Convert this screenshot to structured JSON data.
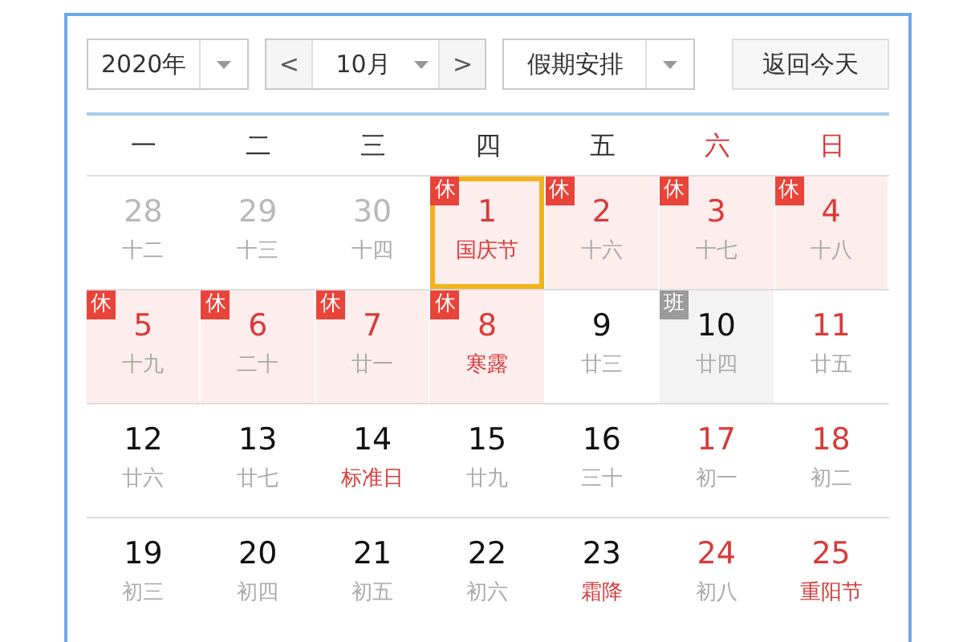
{
  "toolbar": {
    "year": "2020年",
    "prev": "<",
    "month": "10月",
    "next": ">",
    "holiday": "假期安排",
    "today_button": "返回今天"
  },
  "weekdays": [
    {
      "label": "一",
      "weekend": false
    },
    {
      "label": "二",
      "weekend": false
    },
    {
      "label": "三",
      "weekend": false
    },
    {
      "label": "四",
      "weekend": false
    },
    {
      "label": "五",
      "weekend": false
    },
    {
      "label": "六",
      "weekend": true
    },
    {
      "label": "日",
      "weekend": true
    }
  ],
  "weeks": [
    [
      {
        "day": "28",
        "lunar": "十二",
        "other_month": true,
        "festival": false,
        "selected": false
      },
      {
        "day": "29",
        "lunar": "十三",
        "other_month": true,
        "festival": false,
        "selected": false
      },
      {
        "day": "30",
        "lunar": "十四",
        "other_month": true,
        "festival": false,
        "selected": false
      },
      {
        "day": "1",
        "lunar": "国庆节",
        "other_month": false,
        "red": true,
        "festival": true,
        "selected": true,
        "badge": {
          "text": "休",
          "kind": "rest"
        }
      },
      {
        "day": "2",
        "lunar": "十六",
        "other_month": false,
        "red": true,
        "festival": false,
        "selected": false,
        "badge": {
          "text": "休",
          "kind": "rest"
        }
      },
      {
        "day": "3",
        "lunar": "十七",
        "other_month": false,
        "red": true,
        "festival": false,
        "selected": false,
        "badge": {
          "text": "休",
          "kind": "rest"
        }
      },
      {
        "day": "4",
        "lunar": "十八",
        "other_month": false,
        "red": true,
        "festival": false,
        "selected": false,
        "badge": {
          "text": "休",
          "kind": "rest"
        }
      }
    ],
    [
      {
        "day": "5",
        "lunar": "十九",
        "other_month": false,
        "red": true,
        "festival": false,
        "selected": false,
        "badge": {
          "text": "休",
          "kind": "rest"
        }
      },
      {
        "day": "6",
        "lunar": "二十",
        "other_month": false,
        "red": true,
        "festival": false,
        "selected": false,
        "badge": {
          "text": "休",
          "kind": "rest"
        }
      },
      {
        "day": "7",
        "lunar": "廿一",
        "other_month": false,
        "red": true,
        "festival": false,
        "selected": false,
        "badge": {
          "text": "休",
          "kind": "rest"
        }
      },
      {
        "day": "8",
        "lunar": "寒露",
        "other_month": false,
        "red": true,
        "festival": true,
        "selected": false,
        "badge": {
          "text": "休",
          "kind": "rest"
        }
      },
      {
        "day": "9",
        "lunar": "廿三",
        "other_month": false,
        "red": false,
        "festival": false,
        "selected": false
      },
      {
        "day": "10",
        "lunar": "廿四",
        "other_month": false,
        "red": false,
        "festival": false,
        "selected": false,
        "badge": {
          "text": "班",
          "kind": "work"
        }
      },
      {
        "day": "11",
        "lunar": "廿五",
        "other_month": false,
        "red": true,
        "festival": false,
        "selected": false
      }
    ],
    [
      {
        "day": "12",
        "lunar": "廿六",
        "other_month": false,
        "red": false,
        "festival": false,
        "selected": false
      },
      {
        "day": "13",
        "lunar": "廿七",
        "other_month": false,
        "red": false,
        "festival": false,
        "selected": false
      },
      {
        "day": "14",
        "lunar": "标准日",
        "other_month": false,
        "red": false,
        "festival": true,
        "selected": false
      },
      {
        "day": "15",
        "lunar": "廿九",
        "other_month": false,
        "red": false,
        "festival": false,
        "selected": false
      },
      {
        "day": "16",
        "lunar": "三十",
        "other_month": false,
        "red": false,
        "festival": false,
        "selected": false
      },
      {
        "day": "17",
        "lunar": "初一",
        "other_month": false,
        "red": true,
        "festival": false,
        "selected": false
      },
      {
        "day": "18",
        "lunar": "初二",
        "other_month": false,
        "red": true,
        "festival": false,
        "selected": false
      }
    ],
    [
      {
        "day": "19",
        "lunar": "初三",
        "other_month": false,
        "red": false,
        "festival": false,
        "selected": false
      },
      {
        "day": "20",
        "lunar": "初四",
        "other_month": false,
        "red": false,
        "festival": false,
        "selected": false
      },
      {
        "day": "21",
        "lunar": "初五",
        "other_month": false,
        "red": false,
        "festival": false,
        "selected": false
      },
      {
        "day": "22",
        "lunar": "初六",
        "other_month": false,
        "red": false,
        "festival": false,
        "selected": false
      },
      {
        "day": "23",
        "lunar": "霜降",
        "other_month": false,
        "red": false,
        "festival": true,
        "selected": false
      },
      {
        "day": "24",
        "lunar": "初八",
        "other_month": false,
        "red": true,
        "festival": false,
        "selected": false
      },
      {
        "day": "25",
        "lunar": "重阳节",
        "other_month": false,
        "red": true,
        "festival": true,
        "selected": false
      }
    ]
  ]
}
